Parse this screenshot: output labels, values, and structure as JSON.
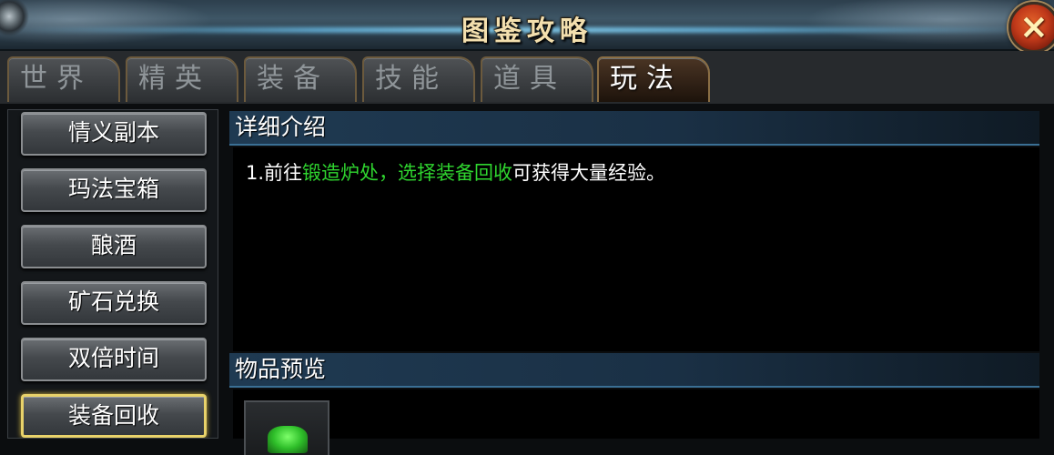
{
  "window": {
    "title": "图鉴攻略",
    "close_label": "×"
  },
  "tabs": [
    {
      "label": "世界",
      "active": false
    },
    {
      "label": "精英",
      "active": false
    },
    {
      "label": "装备",
      "active": false
    },
    {
      "label": "技能",
      "active": false
    },
    {
      "label": "道具",
      "active": false
    },
    {
      "label": "玩法",
      "active": true
    }
  ],
  "sidebar": {
    "items": [
      {
        "label": "情义副本"
      },
      {
        "label": "玛法宝箱"
      },
      {
        "label": "酿酒"
      },
      {
        "label": "矿石兑换"
      },
      {
        "label": "双倍时间"
      },
      {
        "label": "装备回收"
      }
    ],
    "selected_item": "装备回收"
  },
  "detail": {
    "heading": "详细介绍",
    "text_prefix": "1.前往",
    "text_highlight": "锻造炉处，选择装备回收",
    "text_suffix": "可获得大量经验。"
  },
  "preview": {
    "heading": "物品预览",
    "item_icon": "green-gem-icon"
  },
  "colors": {
    "highlight_text": "#2fd52f",
    "selected_border": "#e8d26a",
    "title_text": "#f3dfae"
  }
}
